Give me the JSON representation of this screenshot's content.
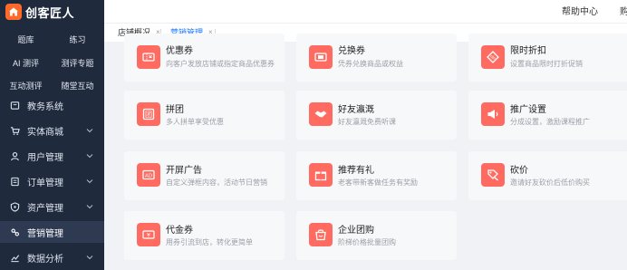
{
  "app": {
    "name": "创客匠人"
  },
  "sidebar": {
    "shortcuts": [
      [
        "题库",
        "练习"
      ],
      [
        "AI 测评",
        "测评专题"
      ],
      [
        "互动测评",
        "随堂互动"
      ]
    ],
    "items": [
      {
        "label": "教务系统",
        "icon": "book-icon",
        "chevron": false
      },
      {
        "label": "实体商城",
        "icon": "cart-icon",
        "chevron": true
      },
      {
        "label": "用户管理",
        "icon": "user-icon",
        "chevron": true
      },
      {
        "label": "订单管理",
        "icon": "order-icon",
        "chevron": true
      },
      {
        "label": "资产管理",
        "icon": "shield-icon",
        "chevron": true
      },
      {
        "label": "营销管理",
        "icon": "marketing-icon",
        "chevron": false,
        "active": true
      },
      {
        "label": "数据分析",
        "icon": "chart-icon",
        "chevron": true
      }
    ]
  },
  "topbar": {
    "help": "帮助中心",
    "extra": "购"
  },
  "tabs": [
    {
      "label": "店铺概况",
      "active": false
    },
    {
      "label": "营销管理",
      "active": true
    }
  ],
  "cards": [
    {
      "title": "优惠券",
      "desc": "向客户发放店铺或指定商品优惠券",
      "icon": "coupon-icon"
    },
    {
      "title": "兑换券",
      "desc": "凭券兑换商品或权益",
      "icon": "voucher-icon"
    },
    {
      "title": "限时折扣",
      "desc": "设置商品限时打折促销",
      "icon": "discount-icon"
    },
    {
      "title": "拼团",
      "desc": "多人拼单享受优惠",
      "icon": "group-buy-icon"
    },
    {
      "title": "好友瀛溉",
      "desc": "好友瀛溉免费听课",
      "icon": "handshake-icon"
    },
    {
      "title": "推广设置",
      "desc": "分成设置，激励课程推广",
      "icon": "megaphone-icon"
    },
    {
      "title": "开屏广告",
      "desc": "自定义弹框内容，活动节日营销",
      "icon": "ad-icon"
    },
    {
      "title": "推荐有礼",
      "desc": "老客带新客做任务有奖励",
      "icon": "gift-icon"
    },
    {
      "title": "砍价",
      "desc": "邀请好友砍价后低价购买",
      "icon": "bargain-icon"
    },
    {
      "title": "代金券",
      "desc": "用券引流到店，转化更简单",
      "icon": "cash-coupon-icon"
    },
    {
      "title": "企业团购",
      "desc": "阶梯价格批量团购",
      "icon": "corporate-buy-icon"
    }
  ],
  "colors": {
    "sidebar_bg": "#1f2a3d",
    "accent": "#ff6b61",
    "brand": "#ff6a2a",
    "link": "#1677ff"
  }
}
